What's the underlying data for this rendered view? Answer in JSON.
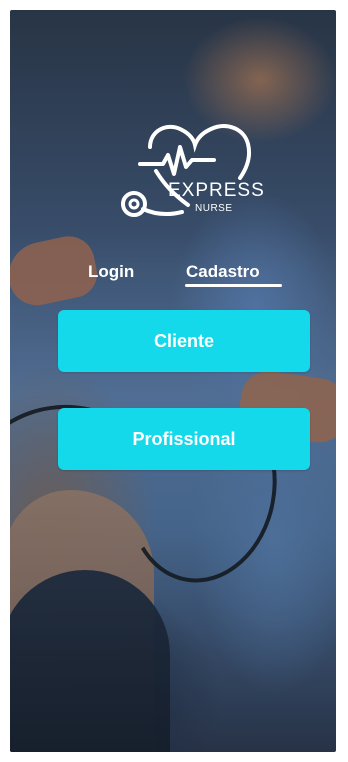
{
  "app": {
    "brand_line_1": "EXPRESS",
    "brand_line_2": "NURSE"
  },
  "tabs": [
    {
      "label": "Login",
      "active": false
    },
    {
      "label": "Cadastro",
      "active": true
    }
  ],
  "buttons": {
    "client": "Cliente",
    "professional": "Profissional"
  },
  "colors": {
    "accent": "#13d9ea",
    "text": "#ffffff"
  },
  "icons": {
    "logo": "stethoscope-heart-icon"
  }
}
